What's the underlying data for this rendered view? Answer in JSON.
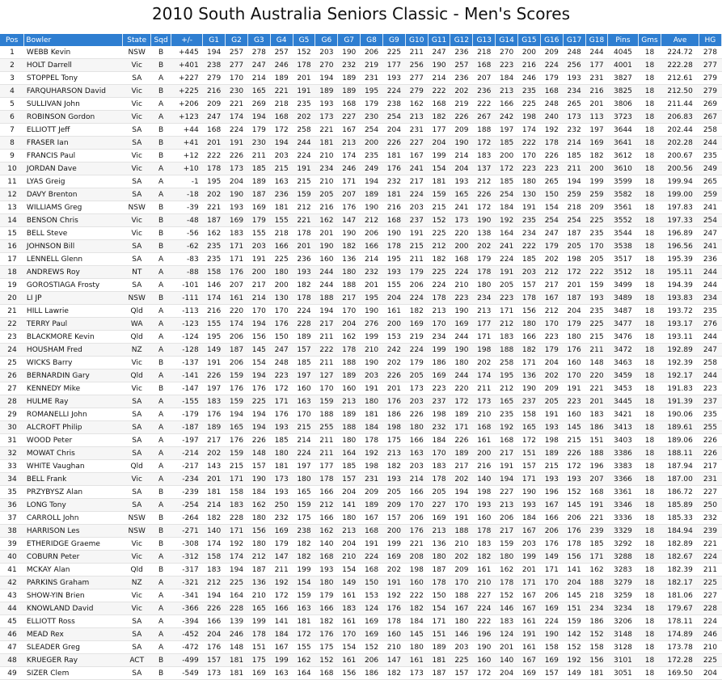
{
  "title": "2010 South Australia Seniors Classic - Men's Scores",
  "headers": [
    "Pos",
    "Bowler",
    "State",
    "Sqd",
    "+/-",
    "G1",
    "G2",
    "G3",
    "G4",
    "G5",
    "G6",
    "G7",
    "G8",
    "G9",
    "G10",
    "G11",
    "G12",
    "G13",
    "G14",
    "G15",
    "G16",
    "G17",
    "G18",
    "Pins",
    "Gms",
    "Ave",
    "HG"
  ],
  "rows": [
    [
      "1",
      "WEBB Kevin",
      "NSW",
      "B",
      "+445",
      "194",
      "257",
      "278",
      "257",
      "152",
      "203",
      "190",
      "206",
      "225",
      "211",
      "247",
      "236",
      "218",
      "270",
      "200",
      "209",
      "248",
      "244",
      "4045",
      "18",
      "224.72",
      "278"
    ],
    [
      "2",
      "HOLT Darrell",
      "Vic",
      "B",
      "+401",
      "238",
      "277",
      "247",
      "246",
      "178",
      "270",
      "232",
      "219",
      "177",
      "256",
      "190",
      "257",
      "168",
      "223",
      "216",
      "224",
      "256",
      "177",
      "4001",
      "18",
      "222.28",
      "277"
    ],
    [
      "3",
      "STOPPEL Tony",
      "SA",
      "A",
      "+227",
      "279",
      "170",
      "214",
      "189",
      "201",
      "194",
      "189",
      "231",
      "193",
      "277",
      "214",
      "236",
      "207",
      "184",
      "246",
      "179",
      "193",
      "231",
      "3827",
      "18",
      "212.61",
      "279"
    ],
    [
      "4",
      "FARQUHARSON David",
      "Vic",
      "B",
      "+225",
      "216",
      "230",
      "165",
      "221",
      "191",
      "189",
      "189",
      "195",
      "224",
      "279",
      "222",
      "202",
      "236",
      "213",
      "235",
      "168",
      "234",
      "216",
      "3825",
      "18",
      "212.50",
      "279"
    ],
    [
      "5",
      "SULLIVAN John",
      "Vic",
      "A",
      "+206",
      "209",
      "221",
      "269",
      "218",
      "235",
      "193",
      "168",
      "179",
      "238",
      "162",
      "168",
      "219",
      "222",
      "166",
      "225",
      "248",
      "265",
      "201",
      "3806",
      "18",
      "211.44",
      "269"
    ],
    [
      "6",
      "ROBINSON Gordon",
      "Vic",
      "A",
      "+123",
      "247",
      "174",
      "194",
      "168",
      "202",
      "173",
      "227",
      "230",
      "254",
      "213",
      "182",
      "226",
      "267",
      "242",
      "198",
      "240",
      "173",
      "113",
      "3723",
      "18",
      "206.83",
      "267"
    ],
    [
      "7",
      "ELLIOTT Jeff",
      "SA",
      "B",
      "+44",
      "168",
      "224",
      "179",
      "172",
      "258",
      "221",
      "167",
      "254",
      "204",
      "231",
      "177",
      "209",
      "188",
      "197",
      "174",
      "192",
      "232",
      "197",
      "3644",
      "18",
      "202.44",
      "258"
    ],
    [
      "8",
      "FRASER Ian",
      "SA",
      "B",
      "+41",
      "201",
      "191",
      "230",
      "194",
      "244",
      "181",
      "213",
      "200",
      "226",
      "227",
      "204",
      "190",
      "172",
      "185",
      "222",
      "178",
      "214",
      "169",
      "3641",
      "18",
      "202.28",
      "244"
    ],
    [
      "9",
      "FRANCIS Paul",
      "Vic",
      "B",
      "+12",
      "222",
      "226",
      "211",
      "203",
      "224",
      "210",
      "174",
      "235",
      "181",
      "167",
      "199",
      "214",
      "183",
      "200",
      "170",
      "226",
      "185",
      "182",
      "3612",
      "18",
      "200.67",
      "235"
    ],
    [
      "10",
      "JORDAN Dave",
      "Vic",
      "A",
      "+10",
      "178",
      "173",
      "185",
      "215",
      "191",
      "234",
      "246",
      "249",
      "176",
      "241",
      "154",
      "204",
      "137",
      "172",
      "223",
      "223",
      "211",
      "200",
      "3610",
      "18",
      "200.56",
      "249"
    ],
    [
      "11",
      "LYAS Greig",
      "SA",
      "A",
      "-1",
      "195",
      "204",
      "189",
      "163",
      "215",
      "210",
      "171",
      "194",
      "232",
      "217",
      "181",
      "193",
      "212",
      "185",
      "180",
      "265",
      "194",
      "199",
      "3599",
      "18",
      "199.94",
      "265"
    ],
    [
      "12",
      "DAVY Brenton",
      "SA",
      "A",
      "-18",
      "202",
      "190",
      "187",
      "236",
      "159",
      "205",
      "207",
      "189",
      "181",
      "224",
      "159",
      "165",
      "226",
      "254",
      "130",
      "150",
      "259",
      "259",
      "3582",
      "18",
      "199.00",
      "259"
    ],
    [
      "13",
      "WILLIAMS Greg",
      "NSW",
      "B",
      "-39",
      "221",
      "193",
      "169",
      "181",
      "212",
      "216",
      "176",
      "190",
      "216",
      "203",
      "215",
      "241",
      "172",
      "184",
      "191",
      "154",
      "218",
      "209",
      "3561",
      "18",
      "197.83",
      "241"
    ],
    [
      "14",
      "BENSON Chris",
      "Vic",
      "B",
      "-48",
      "187",
      "169",
      "179",
      "155",
      "221",
      "162",
      "147",
      "212",
      "168",
      "237",
      "152",
      "173",
      "190",
      "192",
      "235",
      "254",
      "254",
      "225",
      "3552",
      "18",
      "197.33",
      "254"
    ],
    [
      "15",
      "BELL Steve",
      "Vic",
      "B",
      "-56",
      "162",
      "183",
      "155",
      "218",
      "178",
      "201",
      "190",
      "206",
      "190",
      "191",
      "225",
      "220",
      "138",
      "164",
      "234",
      "247",
      "187",
      "235",
      "3544",
      "18",
      "196.89",
      "247"
    ],
    [
      "16",
      "JOHNSON Bill",
      "SA",
      "B",
      "-62",
      "235",
      "171",
      "203",
      "166",
      "201",
      "190",
      "182",
      "166",
      "178",
      "215",
      "212",
      "200",
      "202",
      "241",
      "222",
      "179",
      "205",
      "170",
      "3538",
      "18",
      "196.56",
      "241"
    ],
    [
      "17",
      "LENNELL Glenn",
      "SA",
      "A",
      "-83",
      "235",
      "171",
      "191",
      "225",
      "236",
      "160",
      "136",
      "214",
      "195",
      "211",
      "182",
      "168",
      "179",
      "224",
      "185",
      "202",
      "198",
      "205",
      "3517",
      "18",
      "195.39",
      "236"
    ],
    [
      "18",
      "ANDREWS Roy",
      "NT",
      "A",
      "-88",
      "158",
      "176",
      "200",
      "180",
      "193",
      "244",
      "180",
      "232",
      "193",
      "179",
      "225",
      "224",
      "178",
      "191",
      "203",
      "212",
      "172",
      "222",
      "3512",
      "18",
      "195.11",
      "244"
    ],
    [
      "19",
      "GOROSTIAGA Frosty",
      "SA",
      "A",
      "-101",
      "146",
      "207",
      "217",
      "200",
      "182",
      "244",
      "188",
      "201",
      "155",
      "206",
      "224",
      "210",
      "180",
      "205",
      "157",
      "217",
      "201",
      "159",
      "3499",
      "18",
      "194.39",
      "244"
    ],
    [
      "20",
      "LI JP",
      "NSW",
      "B",
      "-111",
      "174",
      "161",
      "214",
      "130",
      "178",
      "188",
      "217",
      "195",
      "204",
      "224",
      "178",
      "223",
      "234",
      "223",
      "178",
      "167",
      "187",
      "193",
      "3489",
      "18",
      "193.83",
      "234"
    ],
    [
      "21",
      "HILL Lawrie",
      "Qld",
      "A",
      "-113",
      "216",
      "220",
      "170",
      "170",
      "224",
      "194",
      "170",
      "190",
      "161",
      "182",
      "213",
      "190",
      "213",
      "171",
      "156",
      "212",
      "204",
      "235",
      "3487",
      "18",
      "193.72",
      "235"
    ],
    [
      "22",
      "TERRY Paul",
      "WA",
      "A",
      "-123",
      "155",
      "174",
      "194",
      "176",
      "228",
      "217",
      "204",
      "276",
      "200",
      "169",
      "170",
      "169",
      "177",
      "212",
      "180",
      "170",
      "179",
      "225",
      "3477",
      "18",
      "193.17",
      "276"
    ],
    [
      "23",
      "BLACKMORE Kevin",
      "Qld",
      "A",
      "-124",
      "195",
      "206",
      "156",
      "150",
      "189",
      "211",
      "162",
      "199",
      "153",
      "219",
      "234",
      "244",
      "171",
      "183",
      "166",
      "223",
      "180",
      "215",
      "3476",
      "18",
      "193.11",
      "244"
    ],
    [
      "24",
      "HOUSHAM Fred",
      "NZ",
      "A",
      "-128",
      "149",
      "187",
      "145",
      "247",
      "157",
      "222",
      "178",
      "210",
      "242",
      "224",
      "199",
      "190",
      "198",
      "188",
      "182",
      "179",
      "176",
      "211",
      "3472",
      "18",
      "192.89",
      "247"
    ],
    [
      "25",
      "WICKS Barry",
      "Vic",
      "B",
      "-137",
      "191",
      "206",
      "154",
      "248",
      "185",
      "211",
      "188",
      "190",
      "202",
      "179",
      "186",
      "180",
      "202",
      "258",
      "171",
      "204",
      "160",
      "148",
      "3463",
      "18",
      "192.39",
      "258"
    ],
    [
      "26",
      "BERNARDIN Gary",
      "Qld",
      "A",
      "-141",
      "226",
      "159",
      "194",
      "223",
      "197",
      "127",
      "189",
      "203",
      "226",
      "205",
      "169",
      "244",
      "174",
      "195",
      "136",
      "202",
      "170",
      "220",
      "3459",
      "18",
      "192.17",
      "244"
    ],
    [
      "27",
      "KENNEDY Mike",
      "Vic",
      "B",
      "-147",
      "197",
      "176",
      "176",
      "172",
      "160",
      "170",
      "160",
      "191",
      "201",
      "173",
      "223",
      "220",
      "211",
      "212",
      "190",
      "209",
      "191",
      "221",
      "3453",
      "18",
      "191.83",
      "223"
    ],
    [
      "28",
      "HULME Ray",
      "SA",
      "A",
      "-155",
      "183",
      "159",
      "225",
      "171",
      "163",
      "159",
      "213",
      "180",
      "176",
      "203",
      "237",
      "172",
      "173",
      "165",
      "237",
      "205",
      "223",
      "201",
      "3445",
      "18",
      "191.39",
      "237"
    ],
    [
      "29",
      "ROMANELLI John",
      "SA",
      "A",
      "-179",
      "176",
      "194",
      "194",
      "176",
      "170",
      "188",
      "189",
      "181",
      "186",
      "226",
      "198",
      "189",
      "210",
      "235",
      "158",
      "191",
      "160",
      "183",
      "3421",
      "18",
      "190.06",
      "235"
    ],
    [
      "30",
      "ALCROFT Philip",
      "SA",
      "A",
      "-187",
      "189",
      "165",
      "194",
      "193",
      "215",
      "255",
      "188",
      "184",
      "198",
      "180",
      "232",
      "171",
      "168",
      "192",
      "165",
      "193",
      "145",
      "186",
      "3413",
      "18",
      "189.61",
      "255"
    ],
    [
      "31",
      "WOOD Peter",
      "SA",
      "A",
      "-197",
      "217",
      "176",
      "226",
      "185",
      "214",
      "211",
      "180",
      "178",
      "175",
      "166",
      "184",
      "226",
      "161",
      "168",
      "172",
      "198",
      "215",
      "151",
      "3403",
      "18",
      "189.06",
      "226"
    ],
    [
      "32",
      "MOWAT Chris",
      "SA",
      "A",
      "-214",
      "202",
      "159",
      "148",
      "180",
      "224",
      "211",
      "164",
      "192",
      "213",
      "163",
      "170",
      "189",
      "200",
      "217",
      "151",
      "189",
      "226",
      "188",
      "3386",
      "18",
      "188.11",
      "226"
    ],
    [
      "33",
      "WHITE Vaughan",
      "Qld",
      "A",
      "-217",
      "143",
      "215",
      "157",
      "181",
      "197",
      "177",
      "185",
      "198",
      "182",
      "203",
      "183",
      "217",
      "216",
      "191",
      "157",
      "215",
      "172",
      "196",
      "3383",
      "18",
      "187.94",
      "217"
    ],
    [
      "34",
      "BELL Frank",
      "Vic",
      "A",
      "-234",
      "201",
      "171",
      "190",
      "173",
      "180",
      "178",
      "157",
      "231",
      "193",
      "214",
      "178",
      "202",
      "140",
      "194",
      "171",
      "193",
      "193",
      "207",
      "3366",
      "18",
      "187.00",
      "231"
    ],
    [
      "35",
      "PRZYBYSZ Alan",
      "SA",
      "B",
      "-239",
      "181",
      "158",
      "184",
      "193",
      "165",
      "166",
      "204",
      "209",
      "205",
      "166",
      "205",
      "194",
      "198",
      "227",
      "190",
      "196",
      "152",
      "168",
      "3361",
      "18",
      "186.72",
      "227"
    ],
    [
      "36",
      "LONG Tony",
      "SA",
      "A",
      "-254",
      "214",
      "183",
      "162",
      "250",
      "159",
      "212",
      "141",
      "189",
      "209",
      "170",
      "227",
      "170",
      "193",
      "213",
      "193",
      "167",
      "145",
      "191",
      "3346",
      "18",
      "185.89",
      "250"
    ],
    [
      "37",
      "CARROLL John",
      "NSW",
      "B",
      "-264",
      "182",
      "228",
      "180",
      "232",
      "175",
      "166",
      "180",
      "167",
      "157",
      "206",
      "169",
      "191",
      "160",
      "206",
      "184",
      "166",
      "206",
      "221",
      "3336",
      "18",
      "185.33",
      "232"
    ],
    [
      "38",
      "HARRISON Les",
      "NSW",
      "B",
      "-271",
      "140",
      "171",
      "156",
      "169",
      "238",
      "162",
      "213",
      "168",
      "200",
      "176",
      "213",
      "188",
      "178",
      "217",
      "167",
      "206",
      "176",
      "239",
      "3329",
      "18",
      "184.94",
      "239"
    ],
    [
      "39",
      "ETHERIDGE Graeme",
      "Vic",
      "B",
      "-308",
      "174",
      "192",
      "180",
      "179",
      "182",
      "140",
      "204",
      "191",
      "199",
      "221",
      "136",
      "210",
      "183",
      "159",
      "203",
      "176",
      "178",
      "185",
      "3292",
      "18",
      "182.89",
      "221"
    ],
    [
      "40",
      "COBURN Peter",
      "Vic",
      "A",
      "-312",
      "158",
      "174",
      "212",
      "147",
      "182",
      "168",
      "210",
      "224",
      "169",
      "208",
      "180",
      "202",
      "182",
      "180",
      "199",
      "149",
      "156",
      "171",
      "3288",
      "18",
      "182.67",
      "224"
    ],
    [
      "41",
      "MCKAY Alan",
      "Qld",
      "B",
      "-317",
      "183",
      "194",
      "187",
      "211",
      "199",
      "193",
      "154",
      "168",
      "202",
      "198",
      "187",
      "209",
      "161",
      "162",
      "201",
      "171",
      "141",
      "162",
      "3283",
      "18",
      "182.39",
      "211"
    ],
    [
      "42",
      "PARKINS Graham",
      "NZ",
      "A",
      "-321",
      "212",
      "225",
      "136",
      "192",
      "154",
      "180",
      "149",
      "150",
      "191",
      "160",
      "178",
      "170",
      "210",
      "178",
      "171",
      "170",
      "204",
      "188",
      "3279",
      "18",
      "182.17",
      "225"
    ],
    [
      "43",
      "SHOW-YIN Brien",
      "Vic",
      "A",
      "-341",
      "194",
      "164",
      "210",
      "172",
      "159",
      "179",
      "161",
      "153",
      "192",
      "222",
      "150",
      "188",
      "227",
      "152",
      "167",
      "206",
      "145",
      "218",
      "3259",
      "18",
      "181.06",
      "227"
    ],
    [
      "44",
      "KNOWLAND David",
      "Vic",
      "A",
      "-366",
      "226",
      "228",
      "165",
      "166",
      "163",
      "166",
      "183",
      "124",
      "176",
      "182",
      "154",
      "167",
      "224",
      "146",
      "167",
      "169",
      "151",
      "234",
      "3234",
      "18",
      "179.67",
      "228"
    ],
    [
      "45",
      "ELLIOTT Ross",
      "SA",
      "A",
      "-394",
      "166",
      "139",
      "199",
      "141",
      "181",
      "182",
      "161",
      "169",
      "178",
      "184",
      "171",
      "180",
      "222",
      "183",
      "161",
      "224",
      "159",
      "186",
      "3206",
      "18",
      "178.11",
      "224"
    ],
    [
      "46",
      "MEAD Rex",
      "SA",
      "A",
      "-452",
      "204",
      "246",
      "178",
      "184",
      "172",
      "176",
      "170",
      "169",
      "160",
      "145",
      "151",
      "146",
      "196",
      "124",
      "191",
      "190",
      "142",
      "152",
      "3148",
      "18",
      "174.89",
      "246"
    ],
    [
      "47",
      "SLEADER Greg",
      "SA",
      "A",
      "-472",
      "176",
      "148",
      "151",
      "167",
      "155",
      "175",
      "154",
      "152",
      "210",
      "180",
      "189",
      "203",
      "190",
      "201",
      "161",
      "158",
      "152",
      "158",
      "3128",
      "18",
      "173.78",
      "210"
    ],
    [
      "48",
      "KRUEGER Ray",
      "ACT",
      "B",
      "-499",
      "157",
      "181",
      "175",
      "199",
      "162",
      "152",
      "161",
      "206",
      "147",
      "161",
      "181",
      "225",
      "160",
      "140",
      "167",
      "169",
      "192",
      "156",
      "3101",
      "18",
      "172.28",
      "225"
    ],
    [
      "49",
      "SIZER Clem",
      "SA",
      "B",
      "-549",
      "173",
      "181",
      "169",
      "163",
      "164",
      "168",
      "156",
      "186",
      "182",
      "173",
      "187",
      "157",
      "172",
      "204",
      "169",
      "157",
      "149",
      "181",
      "3051",
      "18",
      "169.50",
      "204"
    ]
  ]
}
